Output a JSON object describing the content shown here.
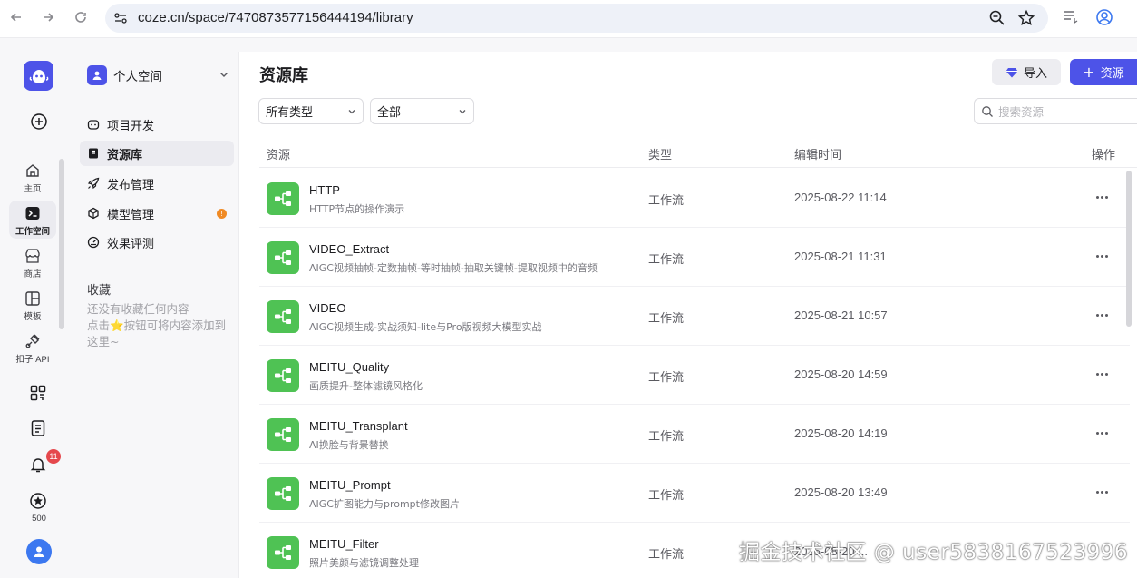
{
  "browser": {
    "url": "coze.cn/space/7470873577156444194/library"
  },
  "rail": {
    "items": [
      {
        "label": "主页",
        "icon": "home-icon"
      },
      {
        "label": "工作空间",
        "icon": "terminal-icon",
        "active": true
      },
      {
        "label": "商店",
        "icon": "store-icon"
      },
      {
        "label": "模板",
        "icon": "template-icon"
      },
      {
        "label": "扣子 API",
        "icon": "api-icon"
      }
    ],
    "notification_count": "11",
    "credits": "500"
  },
  "sidebar": {
    "space_name": "个人空间",
    "items": [
      {
        "label": "项目开发",
        "icon": "robot-icon"
      },
      {
        "label": "资源库",
        "icon": "book-icon",
        "active": true
      },
      {
        "label": "发布管理",
        "icon": "rocket-icon"
      },
      {
        "label": "模型管理",
        "icon": "cube-icon",
        "warning": "!"
      },
      {
        "label": "效果评测",
        "icon": "gauge-icon"
      }
    ],
    "favorites_title": "收藏",
    "favorites_empty_line1": "还没有收藏任何内容",
    "favorites_empty_line2": "点击",
    "favorites_empty_line2b": "按钮可将内容添加到",
    "favorites_empty_line3": "这里~"
  },
  "main": {
    "title": "资源库",
    "import_label": "导入",
    "add_label": "资源",
    "filter_type": "所有类型",
    "filter_scope": "全部",
    "search_placeholder": "搜索资源",
    "columns": [
      "资源",
      "类型",
      "编辑时间",
      "操作"
    ],
    "rows": [
      {
        "name": "HTTP",
        "desc": "HTTP节点的操作演示",
        "type": "工作流",
        "time": "2025-08-22 11:14"
      },
      {
        "name": "VIDEO_Extract",
        "desc": "AIGC视频抽帧-定数抽帧-等时抽帧-抽取关键帧-提取视频中的音频",
        "type": "工作流",
        "time": "2025-08-21 11:31"
      },
      {
        "name": "VIDEO",
        "desc": "AIGC视频生成-实战须知-lite与Pro版视频大模型实战",
        "type": "工作流",
        "time": "2025-08-21 10:57"
      },
      {
        "name": "MEITU_Quality",
        "desc": "画质提升-整体滤镜风格化",
        "type": "工作流",
        "time": "2025-08-20 14:59"
      },
      {
        "name": "MEITU_Transplant",
        "desc": "AI换脸与背景替换",
        "type": "工作流",
        "time": "2025-08-20 14:19"
      },
      {
        "name": "MEITU_Prompt",
        "desc": "AIGC扩图能力与prompt修改图片",
        "type": "工作流",
        "time": "2025-08-20 13:49"
      },
      {
        "name": "MEITU_Filter",
        "desc": "照片美颜与滤镜调整处理",
        "type": "工作流",
        "time": "2025-08-20 ..."
      }
    ]
  },
  "watermark": "掘金技术社区 @ user5838167523996",
  "colors": {
    "accent": "#4d53e8",
    "workflow": "#4fc254",
    "badge": "#e5484d",
    "warn": "#f08a24"
  }
}
